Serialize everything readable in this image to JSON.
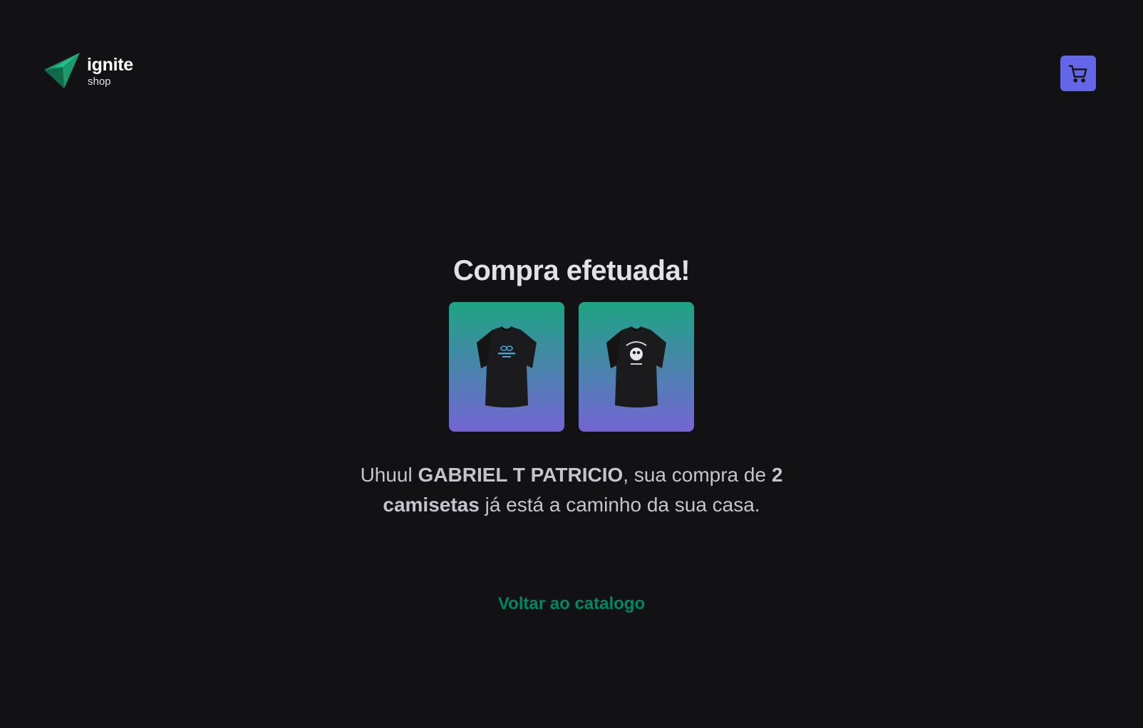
{
  "header": {
    "logo": {
      "title": "ignite",
      "subtitle": "shop",
      "icon": "ignite-logo-icon"
    },
    "cart_button": {
      "icon": "cart-icon"
    }
  },
  "main": {
    "title": "Compra efetuada!",
    "products": [
      {
        "icon": "tshirt-icon",
        "print": "logo"
      },
      {
        "icon": "tshirt-icon",
        "print": "explorer"
      }
    ],
    "message": {
      "prefix": "Uhuul ",
      "customer_name": "GABRIEL T PATRICIO",
      "middle": ", sua compra de ",
      "quantity_text": "2 camisetas",
      "suffix": " já está a caminho da sua casa."
    },
    "back_link": "Voltar ao catalogo"
  },
  "colors": {
    "background": "#121214",
    "accent": "#00875f",
    "cart": "#6366e6",
    "gradient_top": "#1ea483",
    "gradient_bottom": "#7465d4"
  }
}
